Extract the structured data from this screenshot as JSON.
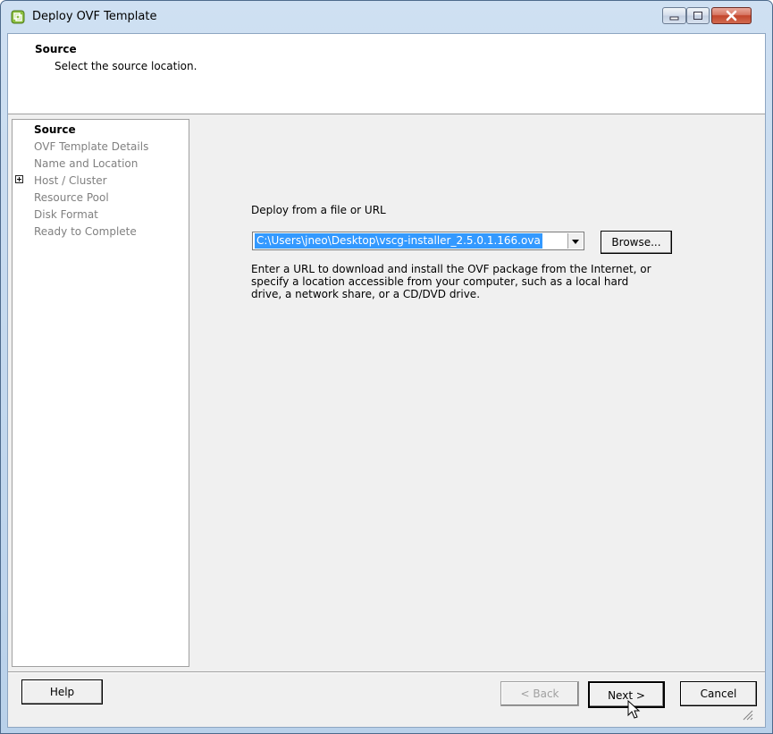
{
  "window": {
    "title": "Deploy OVF Template",
    "app_icon": "vmware-icon",
    "controls": [
      "minimize-icon",
      "maximize-icon",
      "close-icon"
    ]
  },
  "header": {
    "title": "Source",
    "subtitle": "Select the source location."
  },
  "steps": {
    "items": [
      {
        "label": "Source",
        "active": true
      },
      {
        "label": "OVF Template Details",
        "active": false
      },
      {
        "label": "Name and Location",
        "active": false
      },
      {
        "label": "Host / Cluster",
        "active": false,
        "expandable": true
      },
      {
        "label": "Resource Pool",
        "active": false
      },
      {
        "label": "Disk Format",
        "active": false
      },
      {
        "label": "Ready to Complete",
        "active": false
      }
    ]
  },
  "main": {
    "deploy_label": "Deploy from a file or URL",
    "source_value": "C:\\Users\\jneo\\Desktop\\vscg-installer_2.5.0.1.166.ova",
    "browse_label": "Browse...",
    "description": "Enter a URL to download and install the OVF package from the Internet, or specify a location accessible from your computer, such as a local hard drive, a network share, or a CD/DVD drive."
  },
  "footer": {
    "help_label": "Help",
    "back_label": "< Back",
    "next_label": "Next >",
    "cancel_label": "Cancel"
  },
  "colors": {
    "selection": "#3399ff",
    "titlebar": "#c3d7ee",
    "close_button": "#c94a33"
  }
}
